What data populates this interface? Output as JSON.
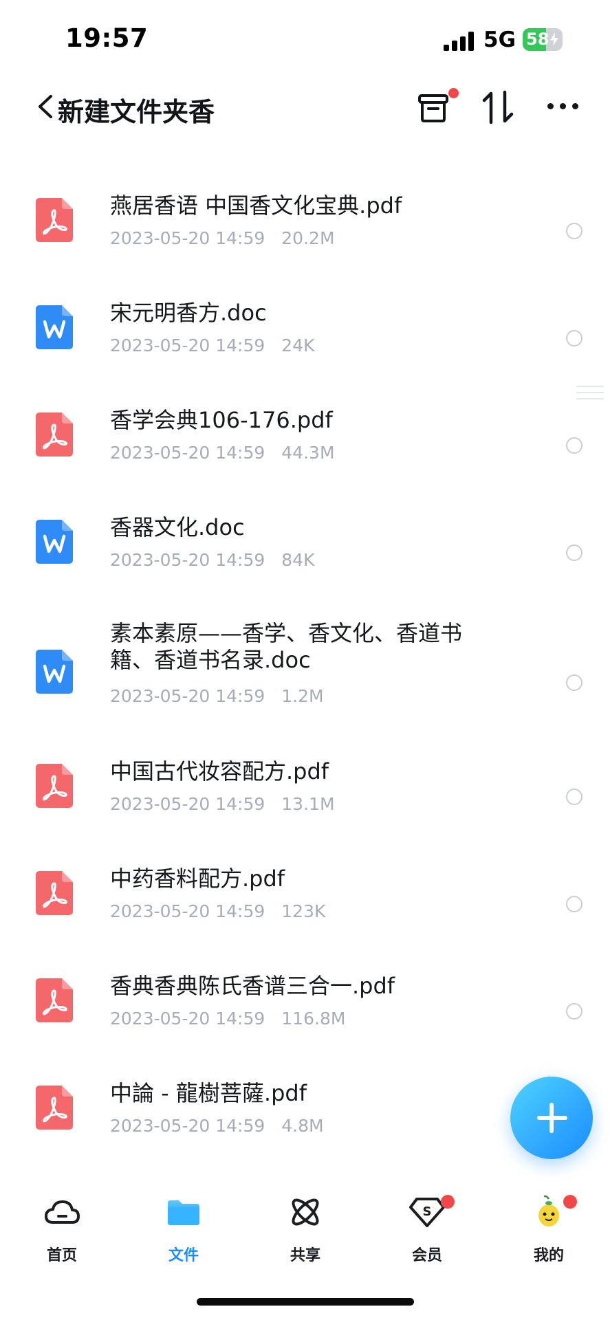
{
  "status_bar": {
    "time": "19:57",
    "network": "5G",
    "battery": "58",
    "battery_level": 0.58,
    "charging": true
  },
  "nav": {
    "title": "新建文件夹香",
    "icons": [
      "back-icon",
      "archive-icon",
      "sort-icon",
      "more-icon"
    ],
    "archive_badge": true
  },
  "files": [
    {
      "name": "燕居香语 中国香文化宝典.pdf",
      "date": "2023-05-20 14:59",
      "size": "20.2M",
      "type": "pdf"
    },
    {
      "name": "宋元明香方.doc",
      "date": "2023-05-20 14:59",
      "size": "24K",
      "type": "doc"
    },
    {
      "name": "香学会典106-176.pdf",
      "date": "2023-05-20 14:59",
      "size": "44.3M",
      "type": "pdf"
    },
    {
      "name": "香器文化.doc",
      "date": "2023-05-20 14:59",
      "size": "84K",
      "type": "doc"
    },
    {
      "name": "素本素原——香学、香文化、香道书籍、香道书名录.doc",
      "date": "2023-05-20 14:59",
      "size": "1.2M",
      "type": "doc"
    },
    {
      "name": "中国古代妆容配方.pdf",
      "date": "2023-05-20 14:59",
      "size": "13.1M",
      "type": "pdf"
    },
    {
      "name": "中药香料配方.pdf",
      "date": "2023-05-20 14:59",
      "size": "123K",
      "type": "pdf"
    },
    {
      "name": "香典香典陈氏香谱三合一.pdf",
      "date": "2023-05-20 14:59",
      "size": "116.8M",
      "type": "pdf"
    },
    {
      "name": "中論 - 龍樹菩薩.pdf",
      "date": "2023-05-20 14:59",
      "size": "4.8M",
      "type": "pdf"
    }
  ],
  "fab": {
    "icon": "plus-icon"
  },
  "tabs": [
    {
      "label": "首页",
      "icon": "cloud-icon",
      "active": false,
      "badge": false
    },
    {
      "label": "文件",
      "icon": "folder-icon",
      "active": true,
      "badge": false
    },
    {
      "label": "共享",
      "icon": "share-orbit-icon",
      "active": false,
      "badge": false
    },
    {
      "label": "会员",
      "icon": "vip-diamond-icon",
      "active": false,
      "badge": true
    },
    {
      "label": "我的",
      "icon": "avatar-icon",
      "active": false,
      "badge": true
    }
  ],
  "colors": {
    "accent": "#1a8cff",
    "pdf": "#f4676b",
    "doc": "#2f8bf6",
    "badge": "#f04848",
    "meta_text": "#a6adb8",
    "battery": "#35c759"
  }
}
